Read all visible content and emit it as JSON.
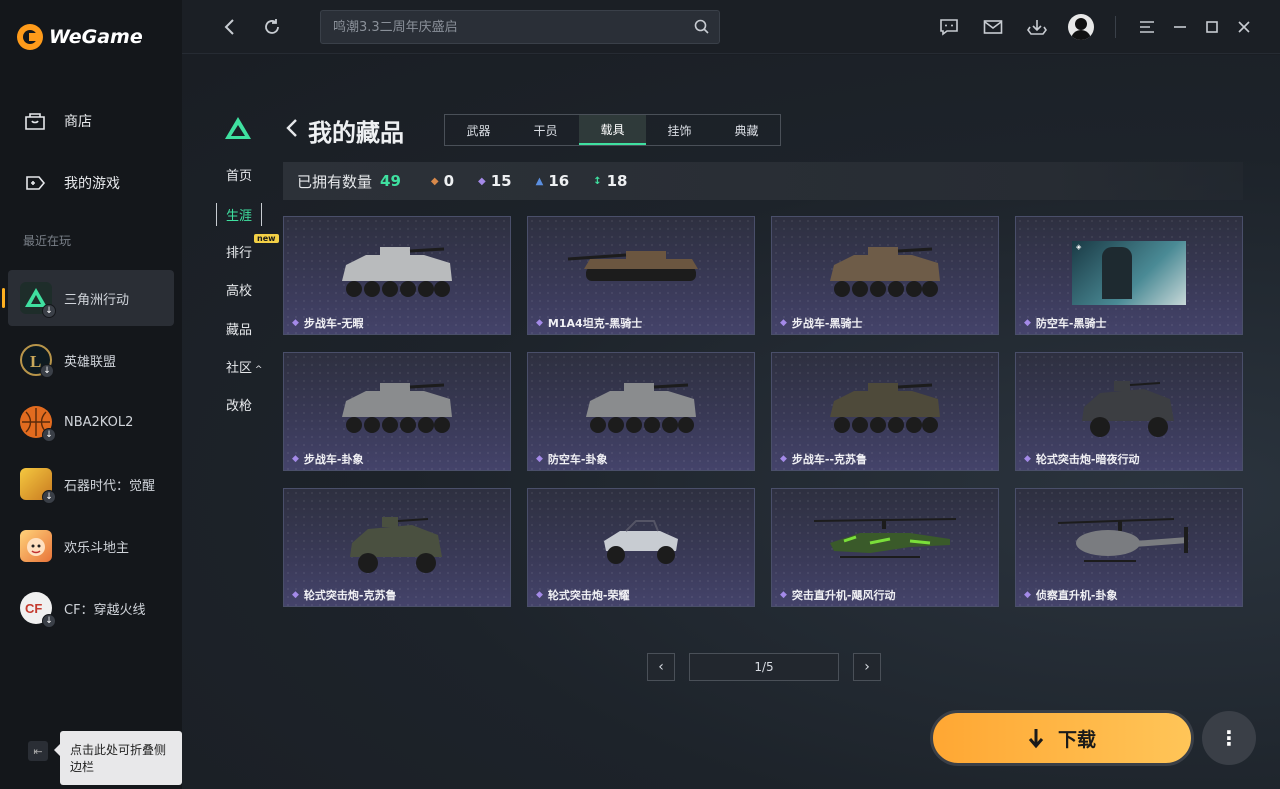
{
  "app": {
    "name": "WeGame"
  },
  "sidebar": {
    "nav": [
      {
        "label": "商店",
        "icon": "store-icon"
      },
      {
        "label": "我的游戏",
        "icon": "gamepad-icon"
      }
    ],
    "recent_label": "最近在玩",
    "games": [
      {
        "label": "三角洲行动",
        "color": "#1e7d5c"
      },
      {
        "label": "英雄联盟",
        "color": "#b8954a"
      },
      {
        "label": "NBA2KOL2",
        "color": "#e26b1f"
      },
      {
        "label": "石器时代：觉醒",
        "color": "#d99a2a"
      },
      {
        "label": "欢乐斗地主",
        "color": "#f0a84a"
      },
      {
        "label": "CF：穿越火线",
        "color": "#c43a2e"
      }
    ],
    "collapse_tip": "点击此处可折叠侧边栏"
  },
  "topbar": {
    "search_placeholder": "鸣潮3.3二周年庆盛启"
  },
  "subnav": {
    "items": [
      "首页",
      "生涯",
      "排行",
      "高校",
      "藏品",
      "社区",
      "改枪"
    ],
    "new_tag": "new",
    "active": "生涯"
  },
  "page": {
    "title": "我的藏品",
    "tabs": [
      "武器",
      "干员",
      "载具",
      "挂饰",
      "典藏"
    ],
    "active_tab": "载具"
  },
  "stats": {
    "label": "已拥有数量",
    "total": "49",
    "rarities": [
      {
        "value": "0",
        "color": "#d8894a"
      },
      {
        "value": "15",
        "color": "#a48ae8"
      },
      {
        "value": "16",
        "color": "#5b8fe0"
      },
      {
        "value": "18",
        "color": "#3fe0a0"
      }
    ]
  },
  "items": [
    {
      "name": "步战车-无暇",
      "kind": "apc",
      "color": "#b9bbbd"
    },
    {
      "name": "M1A4坦克-黑骑士",
      "kind": "tank",
      "color": "#6b5640"
    },
    {
      "name": "步战车-黑骑士",
      "kind": "apc",
      "color": "#6e5c48"
    },
    {
      "name": "防空车-黑骑士",
      "kind": "poster",
      "color": "#2a4a55"
    },
    {
      "name": "步战车-卦象",
      "kind": "apc",
      "color": "#8a8c8e"
    },
    {
      "name": "防空车-卦象",
      "kind": "apc",
      "color": "#8a8c8e"
    },
    {
      "name": "步战车--克苏鲁",
      "kind": "apc",
      "color": "#4e4a3a"
    },
    {
      "name": "轮式突击炮-暗夜行动",
      "kind": "jeep",
      "color": "#3c3e42"
    },
    {
      "name": "轮式突击炮-克苏鲁",
      "kind": "jeep",
      "color": "#4a5040"
    },
    {
      "name": "轮式突击炮-荣耀",
      "kind": "buggy",
      "color": "#c8ccd2"
    },
    {
      "name": "突击直升机-飓风行动",
      "kind": "heli",
      "color": "#3a5a2a"
    },
    {
      "name": "侦察直升机-卦象",
      "kind": "heli2",
      "color": "#7a7c80"
    }
  ],
  "pager": {
    "text": "1/5"
  },
  "download": {
    "label": "下载"
  }
}
